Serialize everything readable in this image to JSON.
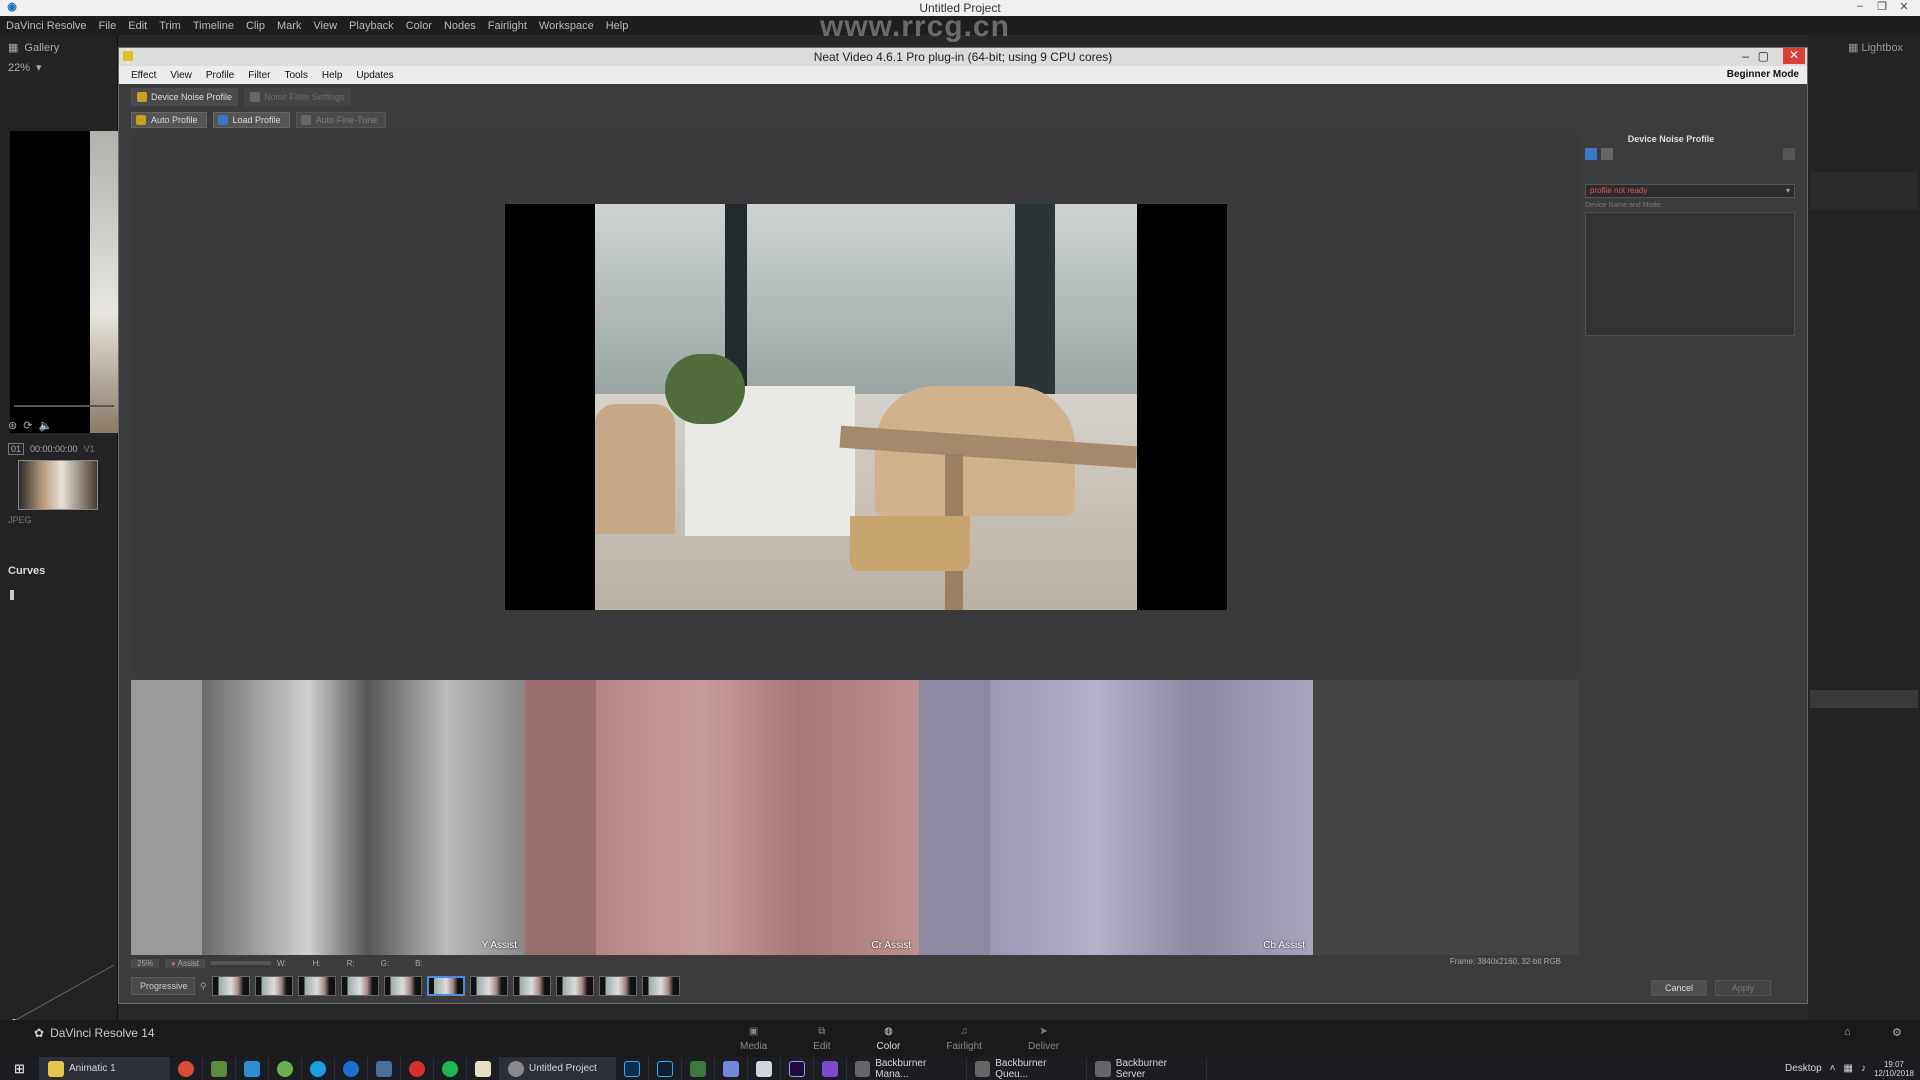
{
  "os_window": {
    "title": "Untitled Project"
  },
  "resolve_menu": [
    "DaVinci Resolve",
    "File",
    "Edit",
    "Trim",
    "Timeline",
    "Clip",
    "Mark",
    "View",
    "Playback",
    "Color",
    "Nodes",
    "Fairlight",
    "Workspace",
    "Help"
  ],
  "resolve_left": {
    "gallery_label": "Gallery",
    "zoom": "22%",
    "clip_number": "01",
    "timecode": "00:00:00:00",
    "track": "V1",
    "clip_type": "JPEG",
    "curves_label": "Curves"
  },
  "resolve_right": {
    "lightbox_label": "Lightbox"
  },
  "neat_video": {
    "title": "Neat Video 4.6.1  Pro plug-in (64-bit; using 9 CPU cores)",
    "menu": [
      "Effect",
      "View",
      "Profile",
      "Filter",
      "Tools",
      "Help",
      "Updates"
    ],
    "mode": "Beginner Mode",
    "tabs": [
      {
        "label": "Device Noise Profile",
        "active": true
      },
      {
        "label": "Noise Filter Settings",
        "active": false
      }
    ],
    "toolbar": {
      "auto_profile": "Auto Profile",
      "load_profile": "Load Profile",
      "auto_fine_tune": "Auto Fine-Tune"
    },
    "right_panel": {
      "header": "Device Noise Profile",
      "profile_status": "profile not ready",
      "device_label": "Device Name and Mode:"
    },
    "assist_views": [
      {
        "label": "Y Assist",
        "tint": "#8a8a8a"
      },
      {
        "label": "Cr Assist",
        "tint": "#b58585"
      },
      {
        "label": "Cb Assist",
        "tint": "#9c97b5"
      }
    ],
    "status": {
      "zoom": "25%",
      "assist": "Assist",
      "channels": [
        "W:",
        "H:",
        "R:",
        "G:",
        "B:"
      ],
      "frame_info": "Frame: 3840x2160, 32-bit RGB"
    },
    "scan_mode": "Progressive",
    "cancel_label": "Cancel",
    "apply_label": "Apply"
  },
  "resolve_bottom": {
    "app_name": "DaVinci Resolve 14",
    "pages": [
      {
        "label": "Media",
        "active": false
      },
      {
        "label": "Edit",
        "active": false
      },
      {
        "label": "Color",
        "active": true
      },
      {
        "label": "Fairlight",
        "active": false
      },
      {
        "label": "Deliver",
        "active": false
      }
    ]
  },
  "taskbar": {
    "apps": [
      "Animatic 1",
      "Untitled Project",
      "Backburner Mana...",
      "Backburner Queu...",
      "Backburner Server"
    ],
    "desktop_label": "Desktop",
    "time": "19:07",
    "date": "12/10/2018"
  },
  "watermark": "www.rrcg.cn",
  "colors": {
    "accent": "#4b8de0",
    "error": "#e05555",
    "window_bg": "#3c3c3e"
  }
}
